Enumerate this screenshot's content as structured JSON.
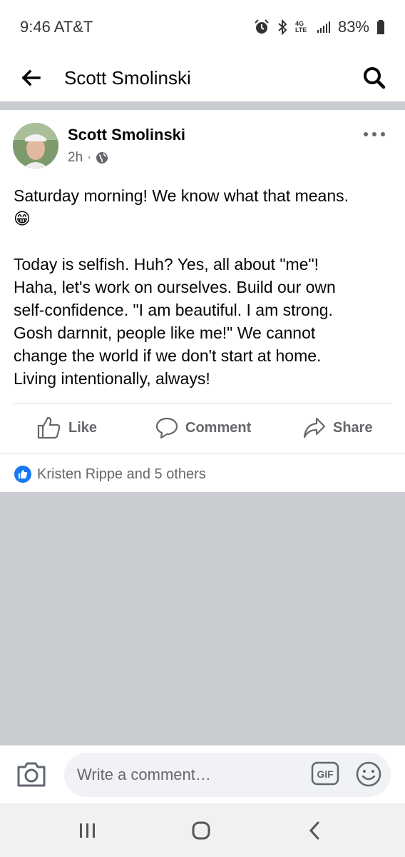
{
  "status_bar": {
    "time": "9:46 AT&T",
    "network": "4G LTE",
    "battery": "83%"
  },
  "top_bar": {
    "title": "Scott Smolinski"
  },
  "post": {
    "author": "Scott Smolinski",
    "time_ago": "2h",
    "separator": "·",
    "privacy_icon": "globe-icon",
    "lines": {
      "l1": "Saturday morning! We know what that means.",
      "l2": "Today is selfish. Huh? Yes, all about \"me\"!",
      "l3": "Haha, let's work on ourselves. Build our own",
      "l4": "self-confidence. \"I am beautiful. I am strong.",
      "l5": "Gosh darnnit, people like me!\" We cannot",
      "l6": "change the world if we don't start at home.",
      "l7": "Living intentionally, always!"
    },
    "emoji": "😁"
  },
  "actions": {
    "like": "Like",
    "comment": "Comment",
    "share": "Share"
  },
  "reactions": {
    "text": "Kristen Rippe and 5 others"
  },
  "comment_bar": {
    "placeholder": "Write a comment…",
    "gif_label": "GIF"
  },
  "colors": {
    "accent": "#1877f2",
    "secondary_text": "#65676b",
    "divider": "#c9ccd1"
  }
}
